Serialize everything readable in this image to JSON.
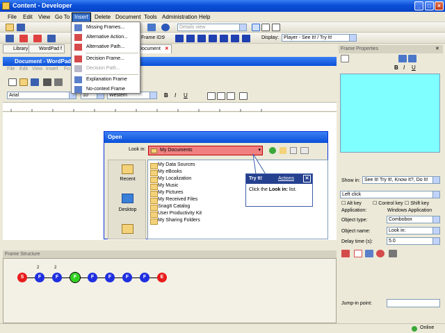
{
  "window": {
    "title": "Content - Developer"
  },
  "menubar": {
    "items": [
      "File",
      "Edit",
      "View",
      "Go To",
      "Insert",
      "Delete",
      "Document",
      "Tools",
      "Administration",
      "Help"
    ],
    "active": "Insert"
  },
  "insert_menu": {
    "items": [
      {
        "label": "Missing Frames...",
        "disabled": false
      },
      {
        "label": "Alternative Action...",
        "disabled": false
      },
      {
        "label": "Alternative Path...",
        "disabled": false
      },
      {
        "label": "Decision Frame...",
        "disabled": false
      },
      {
        "label": "Decision Path...",
        "disabled": true
      },
      {
        "label": "Explanation Frame",
        "disabled": false
      },
      {
        "label": "No-context Frame",
        "disabled": false
      }
    ]
  },
  "toolbar": {
    "view_combo": "Details view",
    "frame_id_label": "Frame ID:",
    "frame_id_value": "9",
    "display_label": "Display:",
    "display_value": "Player - See It! / Try It!"
  },
  "tabs": {
    "library": "Library",
    "wordpad": "WordPad f",
    "document": "Document"
  },
  "wordpad": {
    "title": "Document - WordPad",
    "menu": [
      "File",
      "Edit",
      "View",
      "Insert",
      "Fo"
    ],
    "font": "Arial",
    "size": "10",
    "script": "Western"
  },
  "open_dialog": {
    "title": "Open",
    "look_in_label": "Look in:",
    "look_in_value": "My Documents",
    "places": [
      "Recent",
      "Desktop"
    ],
    "files": [
      "My Data Sources",
      "My eBooks",
      "My Localization",
      "My Music",
      "My Pictures",
      "My Received Files",
      "SnagIt Catalog",
      "User Productivity Kit",
      "My Sharing Folders"
    ]
  },
  "callout": {
    "title": "Try It!",
    "actions": "Actions",
    "text_pre": "Click the ",
    "text_bold": "Look in:",
    "text_post": " list."
  },
  "frame_properties": {
    "title": "Frame Properties",
    "show_in_label": "Show in:",
    "show_in_value": "See It! Try It!, Know It?, Do It!",
    "action": "Left click",
    "keys": [
      "Alt key",
      "Control key",
      "Shift key"
    ],
    "application_label": "Application:",
    "application_value": "Windows Application",
    "object_type_label": "Object type:",
    "object_type_value": "Combobox",
    "object_name_label": "Object name:",
    "object_name_value": "Look in:",
    "delay_label": "Delay time (s):",
    "delay_value": "5.0",
    "jump_in_label": "Jump-in point:"
  },
  "frame_structure": {
    "title": "Frame Structure",
    "nodes": [
      {
        "label": "S",
        "color": "#e81c1c"
      },
      {
        "label": "F",
        "color": "#1f2fe0",
        "num": "2"
      },
      {
        "label": "F",
        "color": "#1f2fe0",
        "num": "2"
      },
      {
        "label": "F",
        "color": "#2fd11f"
      },
      {
        "label": "F",
        "color": "#1f2fe0"
      },
      {
        "label": "F",
        "color": "#1f2fe0"
      },
      {
        "label": "F",
        "color": "#1f2fe0"
      },
      {
        "label": "F",
        "color": "#1f2fe0"
      },
      {
        "label": "E",
        "color": "#e81c1c"
      }
    ]
  },
  "status": {
    "online": "Online"
  }
}
